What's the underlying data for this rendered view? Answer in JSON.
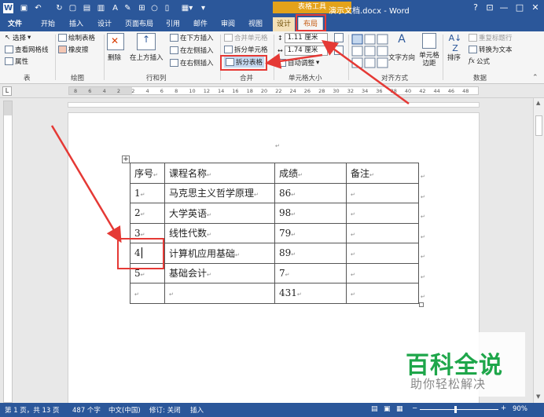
{
  "titlebar": {
    "doc_title": "演示文档.docx - Word",
    "context_label": "表格工具",
    "help": "?",
    "win_buttons": [
      "—",
      "□",
      "✕"
    ]
  },
  "tabs": {
    "file": "文件",
    "home": "开始",
    "insert": "插入",
    "design": "设计",
    "page_layout": "页面布局",
    "references": "引用",
    "mailings": "邮件",
    "review": "审阅",
    "view": "视图",
    "table_design": "设计",
    "layout": "布局"
  },
  "ribbon": {
    "table": {
      "select": "选择",
      "gridlines": "查看网格线",
      "properties": "属性",
      "group": "表"
    },
    "draw": {
      "draw_table": "绘制表格",
      "eraser": "橡皮擦",
      "group": "绘图"
    },
    "rows_cols": {
      "delete": "删除",
      "insert_above": "在上方插入",
      "insert_below": "在下方插入",
      "insert_left": "在左侧插入",
      "insert_right": "在右侧插入",
      "group": "行和列"
    },
    "merge": {
      "merge_cells": "合并单元格",
      "split_cells": "拆分单元格",
      "split_table": "拆分表格",
      "group": "合并"
    },
    "cell_size": {
      "height": "1.11 厘米",
      "width": "1.74 厘米",
      "autofit": "自动调整",
      "group": "单元格大小"
    },
    "alignment": {
      "text_direction": "文字方向",
      "cell_margins": "单元格边距",
      "group": "对齐方式"
    },
    "data": {
      "sort": "排序",
      "repeat_header": "重复标题行",
      "convert_text": "转换为文本",
      "formula": "公式",
      "group": "数据"
    }
  },
  "ruler": {
    "numbers": [
      "8",
      "6",
      "4",
      "2",
      "2",
      "4",
      "6",
      "8",
      "10",
      "12",
      "14",
      "16",
      "18",
      "20",
      "22",
      "24",
      "26",
      "28",
      "30",
      "32",
      "34",
      "36",
      "38",
      "40",
      "42",
      "44",
      "46",
      "48"
    ]
  },
  "table": {
    "headers": [
      "序号",
      "课程名称",
      "成绩",
      "备注"
    ],
    "rows": [
      [
        "1",
        "马克思主义哲学原理",
        "86",
        ""
      ],
      [
        "2",
        "大学英语",
        "98",
        ""
      ],
      [
        "3",
        "线性代数",
        "79",
        ""
      ],
      [
        "4",
        "计算机应用基础",
        "89",
        ""
      ],
      [
        "5",
        "基础会计",
        "7",
        ""
      ],
      [
        "",
        "",
        "431",
        ""
      ]
    ]
  },
  "statusbar": {
    "page": "第 1 页，共 13 页",
    "words": "487 个字",
    "language": "中文(中国)",
    "track": "修订: 关闭",
    "mode": "插入",
    "zoom": "90%"
  },
  "watermark": {
    "title": "百科全说",
    "subtitle": "助你轻松解决"
  },
  "colors": {
    "brand": "#2b579a",
    "accent": "#e53935",
    "context": "#e3a21a"
  }
}
